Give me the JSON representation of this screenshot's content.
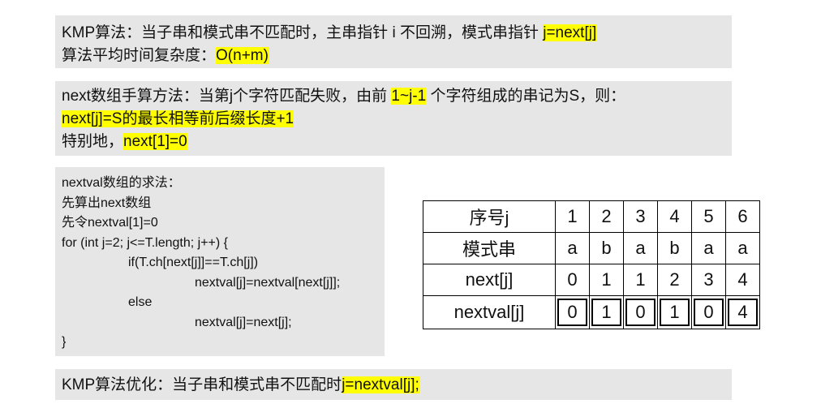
{
  "box1": {
    "line1_text": "KMP算法：当子串和模式串不匹配时，主串指针 i 不回溯，模式串指针 ",
    "line1_highlight": "j=next[j]",
    "line2_text": "算法平均时间复杂度：",
    "line2_highlight": "O(n+m)"
  },
  "box2": {
    "line1_text": "next数组手算方法：当第j个字符匹配失败，由前 ",
    "line1_highlight": "1~j-1",
    "line1_tail": " 个字符组成的串记为S，则：",
    "line2_highlight": "next[j]=S的最长相等前后缀长度+1",
    "line3_text": "特别地，",
    "line3_highlight": "next[1]=0"
  },
  "box3": {
    "lines": [
      "nextval数组的求法：",
      "先算出next数组",
      "先令nextval[1]=0",
      "for (int j=2; j<=T.length; j++) {",
      "if(T.ch[next[j]]==T.ch[j])",
      "nextval[j]=nextval[next[j]];",
      "else",
      "nextval[j]=next[j];",
      "}"
    ]
  },
  "box4": {
    "text": "KMP算法优化：当子串和模式串不匹配时",
    "highlight": "j=nextval[j];"
  },
  "table": {
    "rows": [
      {
        "header": "序号j",
        "values": [
          "1",
          "2",
          "3",
          "4",
          "5",
          "6"
        ]
      },
      {
        "header": "模式串",
        "values": [
          "a",
          "b",
          "a",
          "b",
          "a",
          "a"
        ]
      },
      {
        "header": "next[j]",
        "values": [
          "0",
          "1",
          "1",
          "2",
          "3",
          "4"
        ]
      },
      {
        "header": "nextval[j]",
        "values": [
          "0",
          "1",
          "0",
          "1",
          "0",
          "4"
        ]
      }
    ]
  },
  "colors": {
    "box_background": "#e6e6e6",
    "highlight": "#ffff00"
  }
}
